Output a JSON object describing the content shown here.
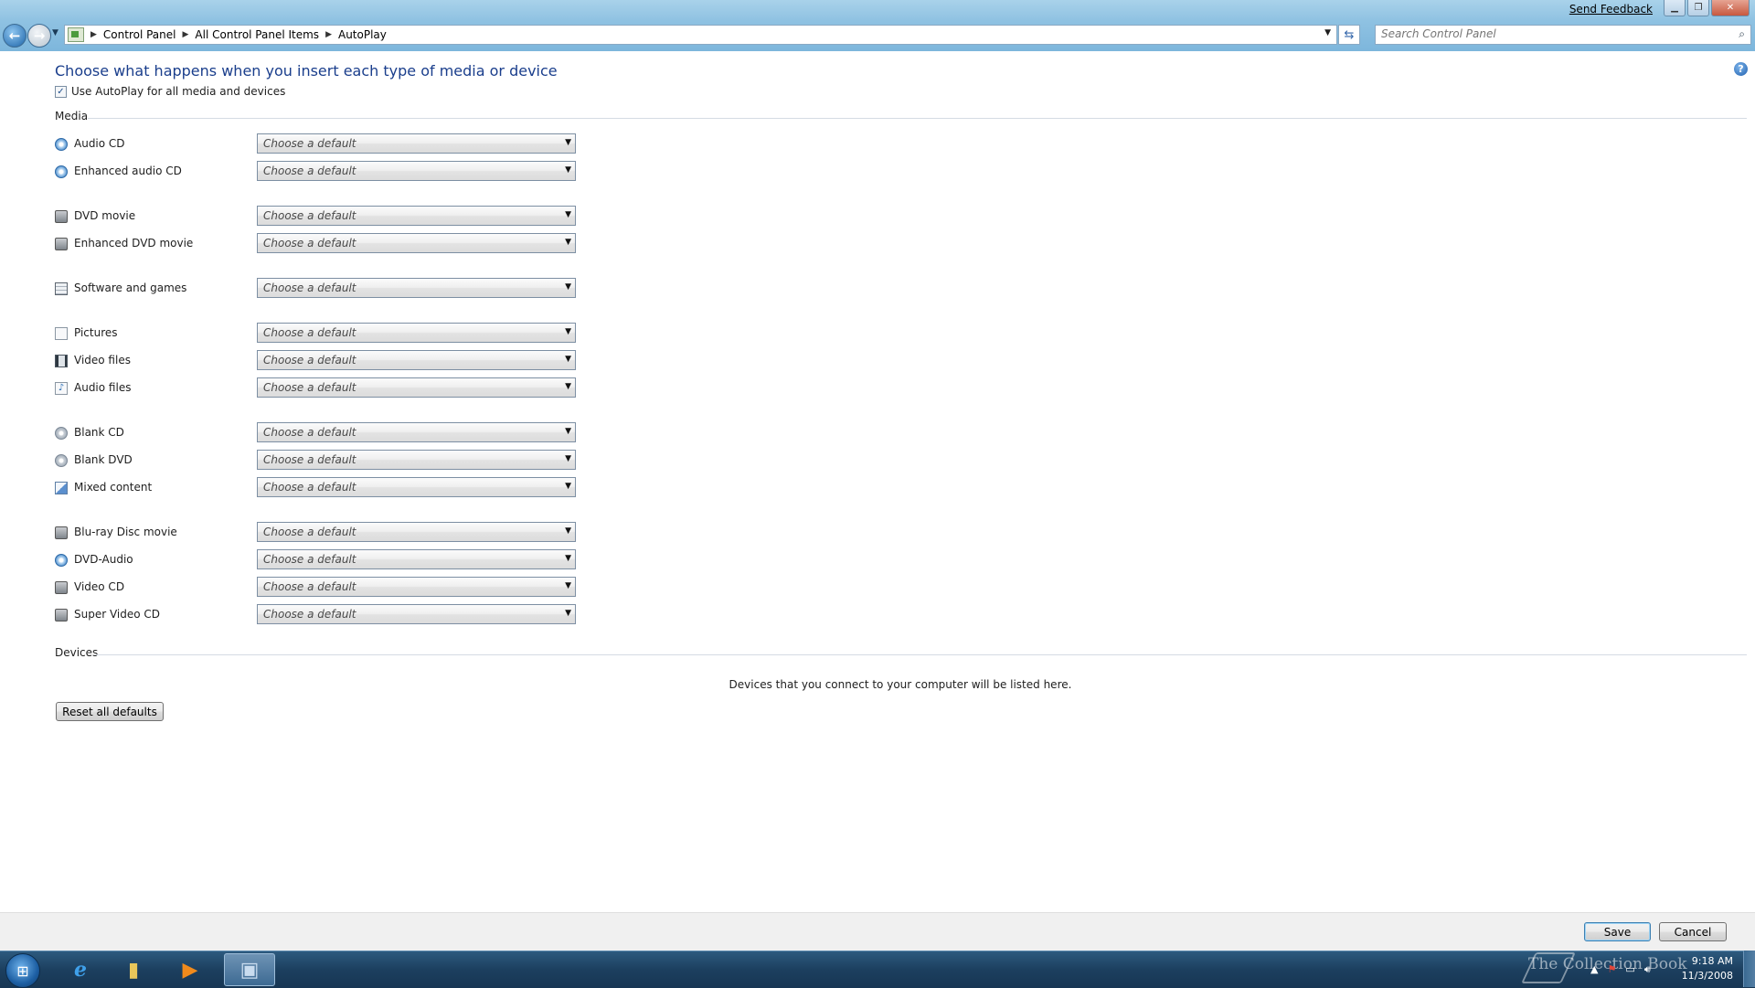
{
  "window": {
    "send_feedback": "Send Feedback",
    "caption_buttons": [
      "minimize",
      "restore",
      "close"
    ]
  },
  "nav": {
    "back_label": "Back",
    "forward_label": "Forward"
  },
  "address": {
    "breadcrumbs": [
      "Control Panel",
      "All Control Panel Items",
      "AutoPlay"
    ]
  },
  "search": {
    "placeholder": "Search Control Panel"
  },
  "content": {
    "heading": "Choose what happens when you insert each type of media or device",
    "use_autoplay_label": "Use AutoPlay for all media and devices",
    "use_autoplay_checked": true,
    "media_title": "Media",
    "devices_title": "Devices",
    "devices_message": "Devices that you connect to your computer will be listed here.",
    "reset_button": "Reset all defaults"
  },
  "media": [
    {
      "label": "Audio CD",
      "icon": "audio-cd-icon",
      "value": "Choose a default"
    },
    {
      "label": "Enhanced audio CD",
      "icon": "enhanced-audio-cd-icon",
      "value": "Choose a default"
    },
    {
      "label": "DVD movie",
      "icon": "dvd-movie-icon",
      "value": "Choose a default"
    },
    {
      "label": "Enhanced DVD movie",
      "icon": "enhanced-dvd-movie-icon",
      "value": "Choose a default"
    },
    {
      "label": "Software and games",
      "icon": "software-games-icon",
      "value": "Choose a default"
    },
    {
      "label": "Pictures",
      "icon": "pictures-icon",
      "value": "Choose a default"
    },
    {
      "label": "Video files",
      "icon": "video-files-icon",
      "value": "Choose a default"
    },
    {
      "label": "Audio files",
      "icon": "audio-files-icon",
      "value": "Choose a default"
    },
    {
      "label": "Blank CD",
      "icon": "blank-cd-icon",
      "value": "Choose a default"
    },
    {
      "label": "Blank DVD",
      "icon": "blank-dvd-icon",
      "value": "Choose a default"
    },
    {
      "label": "Mixed content",
      "icon": "mixed-content-icon",
      "value": "Choose a default"
    },
    {
      "label": "Blu-ray Disc movie",
      "icon": "bluray-movie-icon",
      "value": "Choose a default"
    },
    {
      "label": "DVD-Audio",
      "icon": "dvd-audio-icon",
      "value": "Choose a default"
    },
    {
      "label": "Video CD",
      "icon": "video-cd-icon",
      "value": "Choose a default"
    },
    {
      "label": "Super Video CD",
      "icon": "super-video-cd-icon",
      "value": "Choose a default"
    }
  ],
  "footer": {
    "save": "Save",
    "cancel": "Cancel"
  },
  "taskbar": {
    "watermark": "The Collection Book",
    "time": "9:18 AM",
    "date": "11/3/2008"
  },
  "colors": {
    "heading": "#1a3e8c",
    "taskbar": "#1c3f5f",
    "titlebar": "#8fc2e2"
  }
}
